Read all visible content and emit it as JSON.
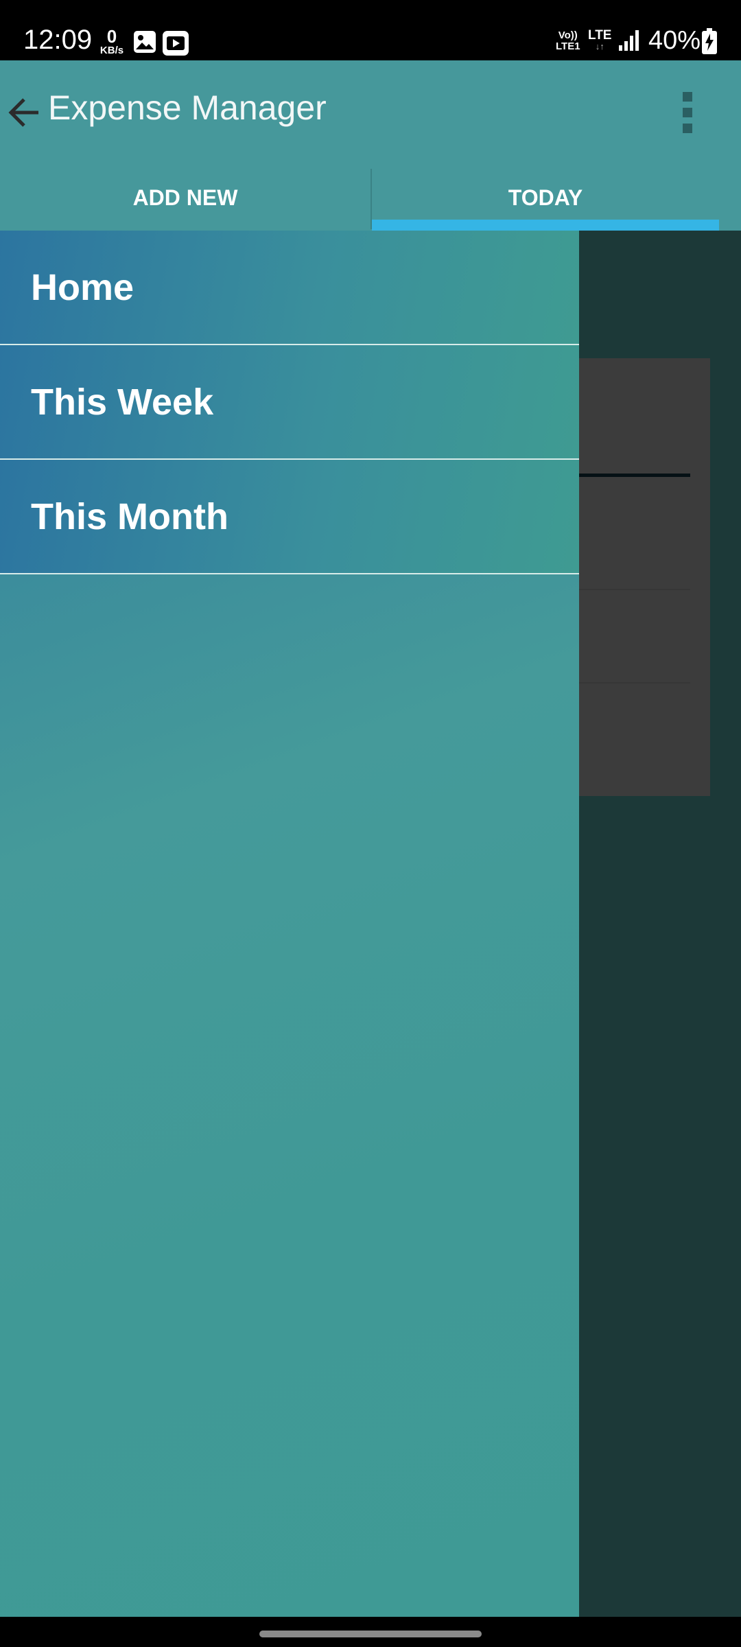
{
  "status_bar": {
    "time": "12:09",
    "net_speed_value": "0",
    "net_speed_unit": "KB/s",
    "volte_label_1": "Vo))",
    "volte_label_2": "LTE1",
    "network_type": "LTE",
    "battery_percent": "40%",
    "icons": [
      "gallery-icon",
      "youtube-icon",
      "signal-icon",
      "battery-charging-icon"
    ]
  },
  "app_bar": {
    "title": "Expense Manager",
    "back_icon": "arrow-left-icon",
    "overflow_icon": "more-vert-icon"
  },
  "tabs": [
    {
      "label": "ADD NEW",
      "selected": false
    },
    {
      "label": "TODAY",
      "selected": true
    }
  ],
  "drawer": {
    "items": [
      {
        "label": "Home"
      },
      {
        "label": "This Week"
      },
      {
        "label": "This Month"
      }
    ]
  },
  "colors": {
    "primary": "#46989b",
    "tab_indicator": "#35b5e5",
    "drawer_gradient_start": "#2a73a0",
    "drawer_gradient_end": "#3f9a95"
  }
}
